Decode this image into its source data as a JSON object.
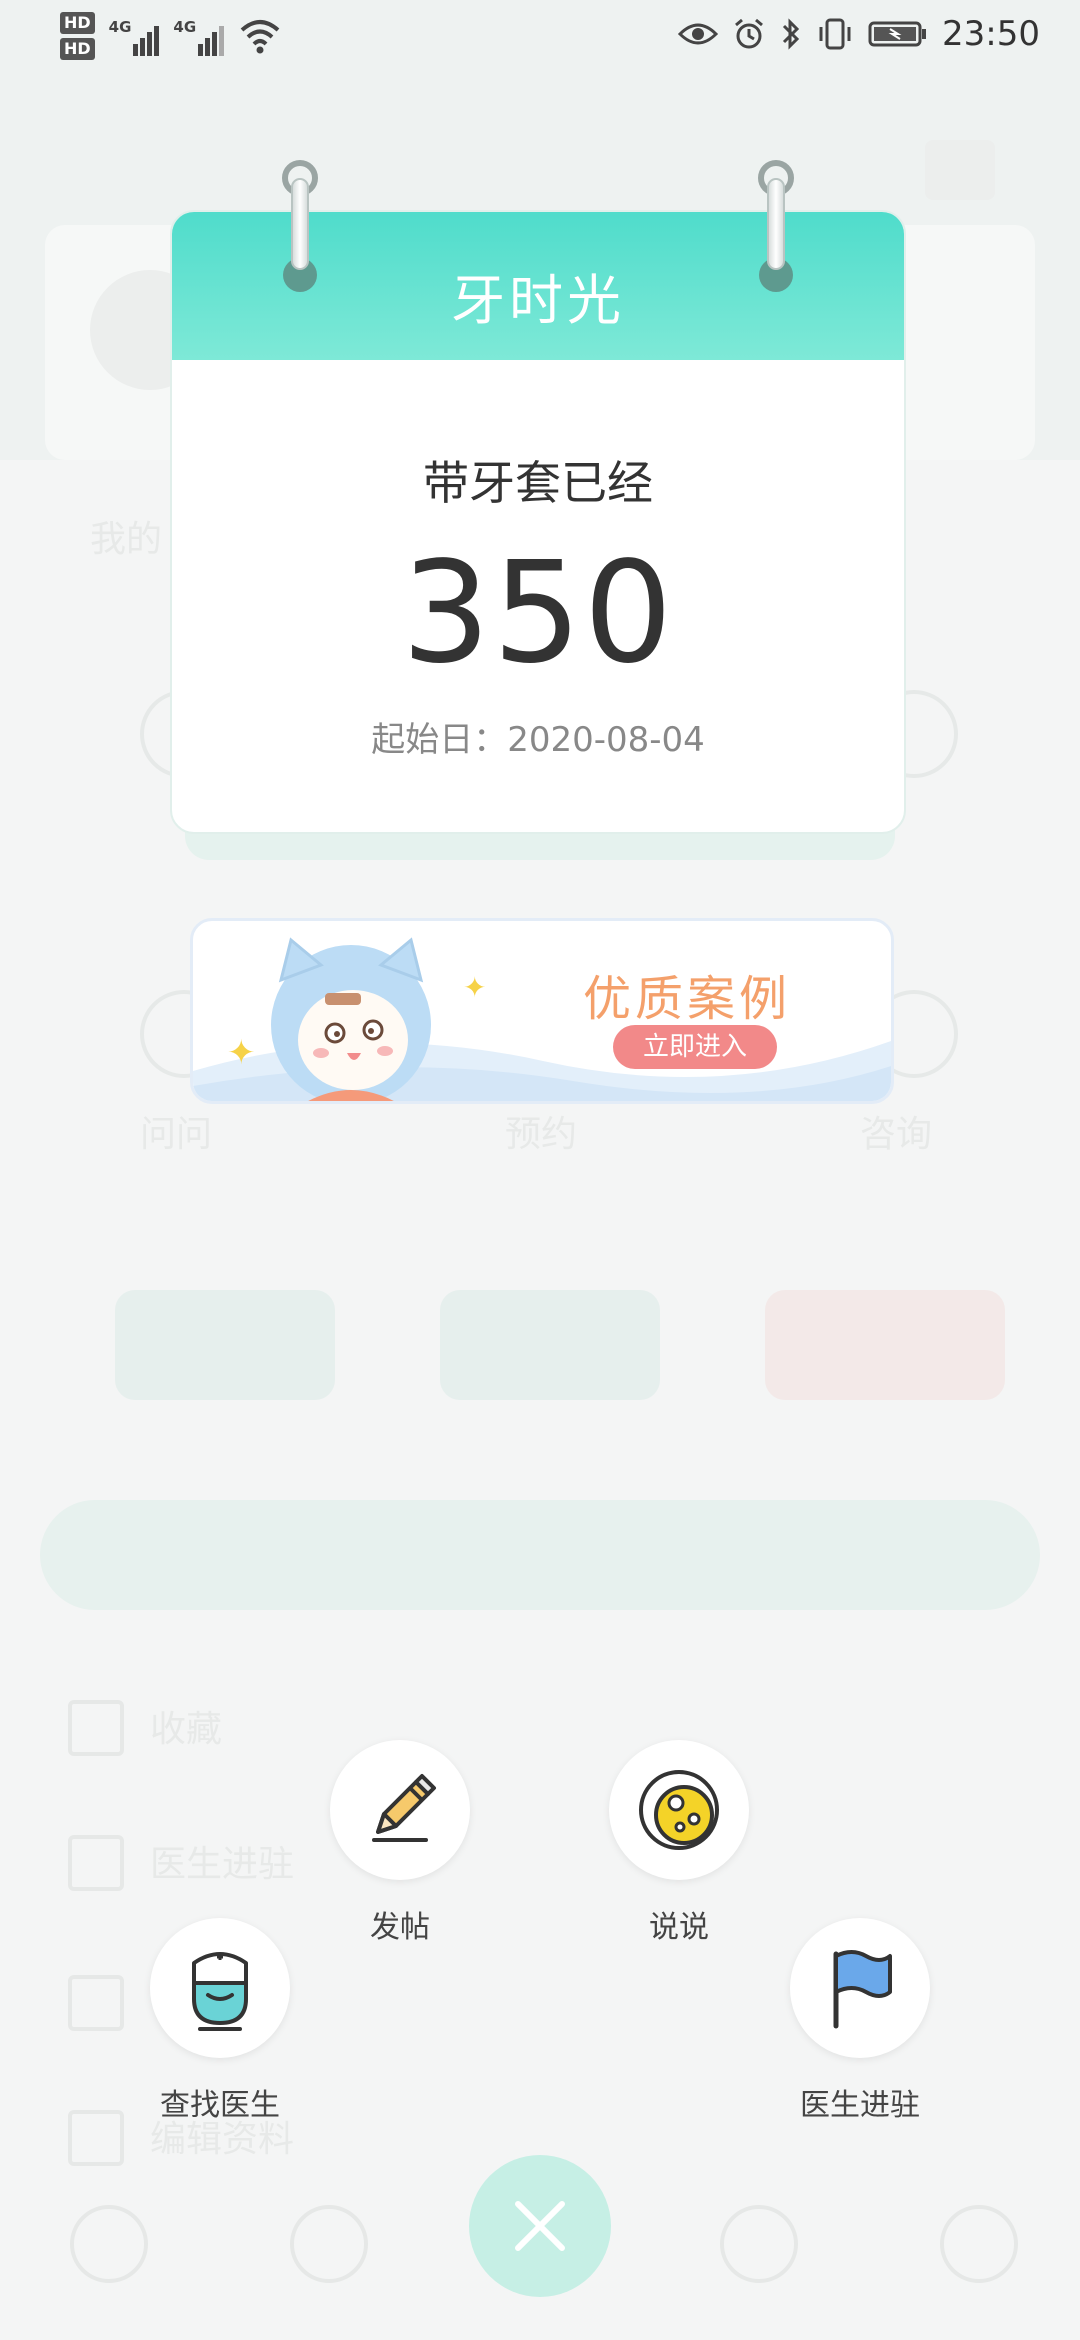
{
  "status_bar": {
    "time": "23:50",
    "sim1_label": "HD",
    "sim2_label": "HD",
    "network1": "4G",
    "network2": "4G"
  },
  "calendar": {
    "title": "牙时光",
    "label": "带牙套已经",
    "days": "350",
    "start_date_text": "起始日：2020-08-04"
  },
  "promo": {
    "title": "优质案例",
    "button_label": "立即进入"
  },
  "actions": {
    "post": {
      "label": "发帖",
      "icon": "pencil-icon"
    },
    "moment": {
      "label": "说说",
      "icon": "moment-icon"
    },
    "find_doctor": {
      "label": "查找医生",
      "icon": "doctor-icon"
    },
    "doctor_join": {
      "label": "医生进驻",
      "icon": "flag-icon"
    }
  },
  "background": {
    "my_label": "我的",
    "grid_labels": [
      "问问",
      "预约",
      "咨询"
    ],
    "list_items": [
      "收藏",
      "医生进驻",
      "编辑资料"
    ]
  },
  "colors": {
    "accent": "#4fdccb",
    "promo_orange": "#f4a06b",
    "promo_button": "#f28989",
    "close_fab": "#c6efe5"
  }
}
